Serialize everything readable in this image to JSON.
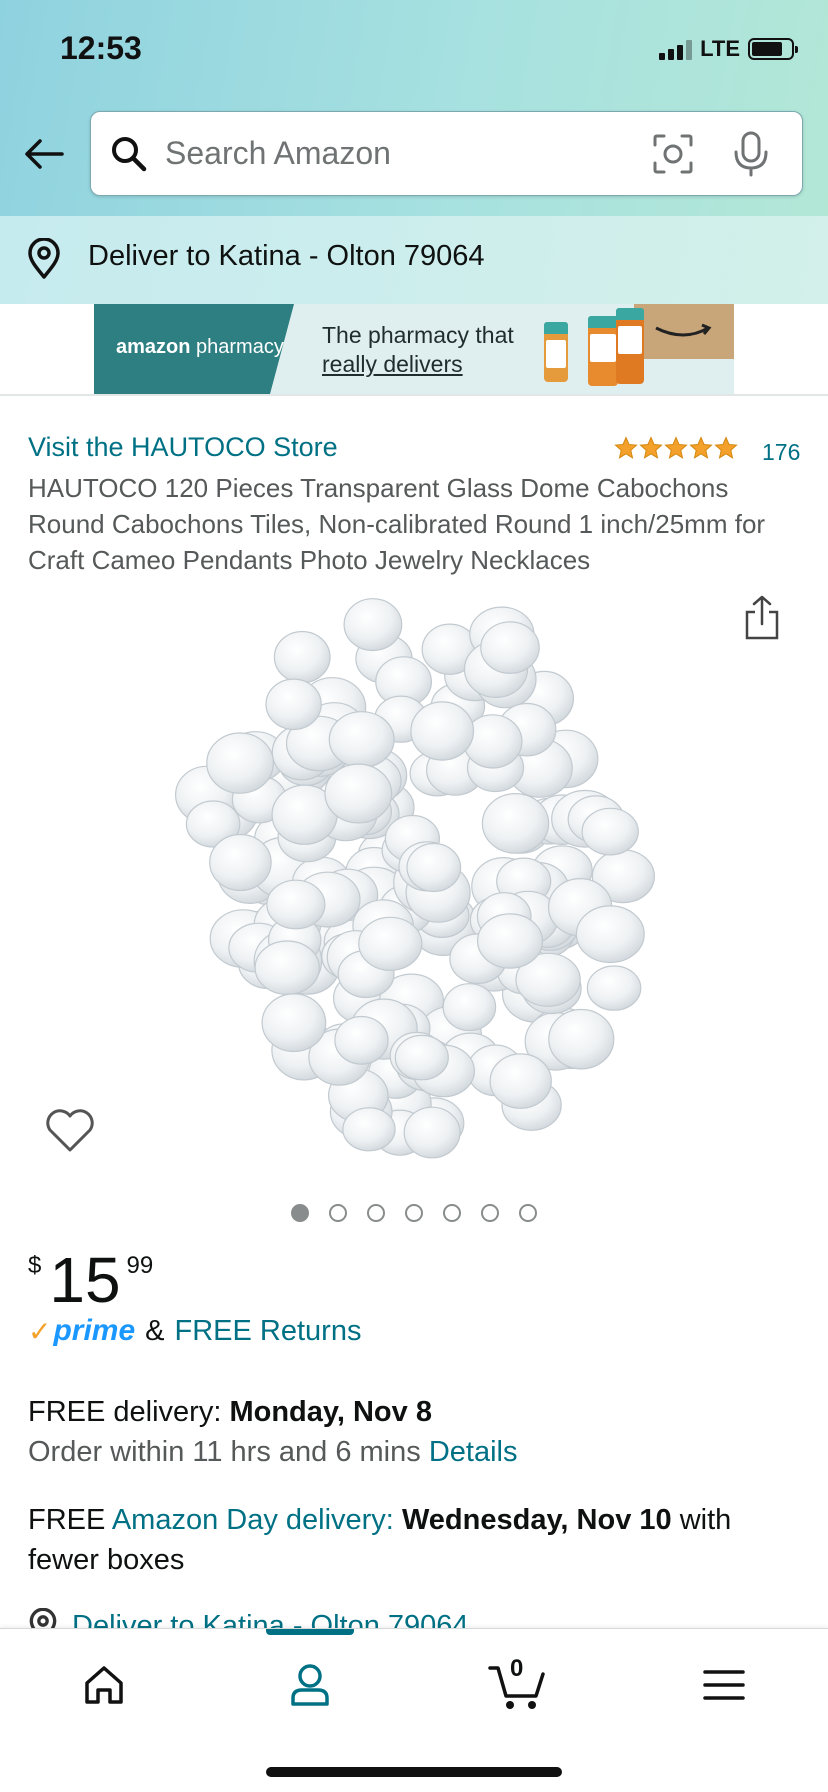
{
  "status_bar": {
    "time": "12:53",
    "network": "LTE"
  },
  "search": {
    "placeholder": "Search Amazon"
  },
  "delivery_location": "Deliver to Katina - Olton 79064",
  "banner": {
    "brand": "amazon",
    "brand_suffix": " pharmacy",
    "line1": "The pharmacy that",
    "line2": "really delivers"
  },
  "product": {
    "store_link": "Visit the HAUTOCO Store",
    "rating_stars": 5,
    "rating_count": "176",
    "title": "HAUTOCO 120 Pieces Transparent Glass Dome Cabochons Round Cabochons Tiles, Non-calibrated Round 1 inch/25mm for Craft Cameo Pendants Photo Jewelry Necklaces",
    "image_count": 7,
    "active_image": 0
  },
  "price": {
    "currency": "$",
    "whole": "15",
    "fraction": "99"
  },
  "prime": {
    "logo": "prime",
    "amp": "&",
    "free_returns": "FREE Returns"
  },
  "delivery": {
    "free_label": "FREE delivery: ",
    "date": "Monday, Nov 8",
    "order_within": "Order within 11 hrs and 6 mins ",
    "details_link": "Details",
    "amazon_day_free": "FREE ",
    "amazon_day_link": "Amazon Day delivery:",
    "amazon_day_date": "Wednesday, Nov 10",
    "amazon_day_suffix": " with fewer boxes",
    "deliver_to_link": "Deliver to Katina - Olton 79064"
  },
  "bottom_nav": {
    "cart_count": "0"
  },
  "colors": {
    "link": "#007185",
    "star": "#f4a12b",
    "prime_blue": "#1a98ff"
  }
}
